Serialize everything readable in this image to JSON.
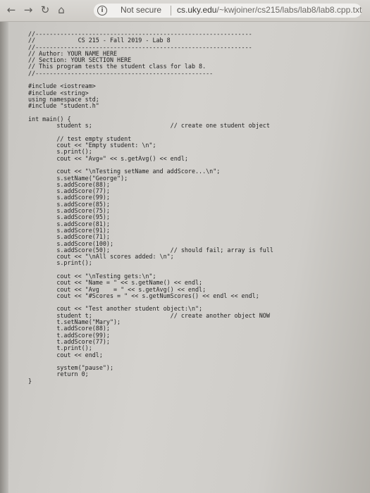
{
  "browser": {
    "back_icon": "←",
    "forward_icon": "→",
    "reload_icon": "↻",
    "home_icon": "⌂",
    "security_icon": "i",
    "security_label": "Not secure",
    "url_host": "cs.uky.edu",
    "url_path": "/~kwjoiner/cs215/labs/lab8/lab8.cpp.txt"
  },
  "code_lines": [
    "//-------------------------------------------------------------",
    "//            CS 215 - Fall 2019 - Lab 8",
    "//-------------------------------------------------------------",
    "// Author: YOUR NAME HERE",
    "// Section: YOUR SECTION HERE",
    "// This program tests the student class for lab 8.",
    "//--------------------------------------------------",
    "",
    "#include <iostream>",
    "#include <string>",
    "using namespace std;",
    "#include \"student.h\"",
    "",
    "int main() {",
    "        student s;                      // create one student object",
    "",
    "        // test empty student",
    "        cout << \"Empty student: \\n\";",
    "        s.print();",
    "        cout << \"Avg=\" << s.getAvg() << endl;",
    "",
    "        cout << \"\\nTesting setName and addScore...\\n\";",
    "        s.setName(\"George\");",
    "        s.addScore(88);",
    "        s.addScore(77);",
    "        s.addScore(99);",
    "        s.addScore(85);",
    "        s.addScore(75);",
    "        s.addScore(95);",
    "        s.addScore(81);",
    "        s.addScore(91);",
    "        s.addScore(71);",
    "        s.addScore(100);",
    "        s.addScore(50);                 // should fail; array is full",
    "        cout << \"\\nAll scores added: \\n\";",
    "        s.print();",
    "",
    "        cout << \"\\nTesting gets:\\n\";",
    "        cout << \"Name = \" << s.getName() << endl;",
    "        cout << \"Avg    = \" << s.getAvg() << endl;",
    "        cout << \"#Scores = \" << s.getNumScores() << endl << endl;",
    "",
    "        cout << \"Test another student object:\\n\";",
    "        student t;                      // create another object NOW",
    "        t.setName(\"Mary\");",
    "        t.addScore(88);",
    "        t.addScore(99);",
    "        t.addScore(77);",
    "        t.print();",
    "        cout << endl;",
    "",
    "        system(\"pause\");",
    "        return 0;",
    "}"
  ]
}
